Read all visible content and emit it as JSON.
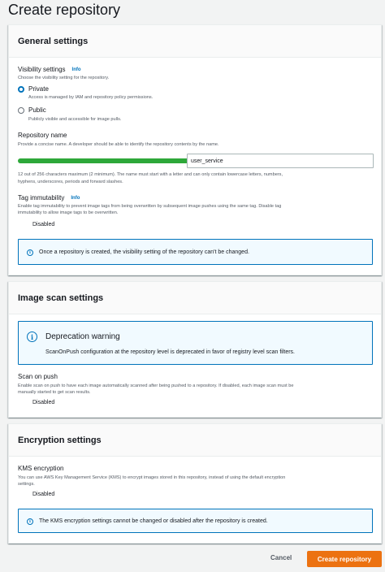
{
  "page": {
    "title": "Create repository"
  },
  "general": {
    "title": "General settings",
    "visibility_label": "Visibility settings",
    "visibility_info": "Info",
    "visibility_desc": "Choose the visibility setting for the repository.",
    "private_label": "Private",
    "private_desc": "Access is managed by IAM and repository policy permissions.",
    "public_label": "Public",
    "public_desc": "Publicly visible and accessible for image pulls.",
    "repo_name_label": "Repository name",
    "repo_name_desc": "Provide a concise name. A developer should be able to identify the repository contents by the name.",
    "repo_prefix_sep": "/",
    "repo_name_value": "user_service",
    "repo_name_hint_1": "12 out of 256 characters maximum (2 minimum). The name must start with a letter and can only contain lowercase letters, numbers,",
    "repo_name_hint_2": "hyphens, underscores, periods and forward slashes.",
    "tag_label": "Tag immutability",
    "tag_info": "Info",
    "tag_desc_1": "Enable tag immutability to prevent image tags from being overwritten by subsequent image pushes using the same tag. Disable tag",
    "tag_desc_2": "immutability to allow image tags to be overwritten.",
    "tag_toggle_label": "Disabled",
    "alert_text": "Once a repository is created, the visibility setting of the repository can't be changed."
  },
  "scan": {
    "title": "Image scan settings",
    "warning_title": "Deprecation warning",
    "warning_text": "ScanOnPush configuration at the repository level is deprecated in favor of registry level scan filters.",
    "scan_label": "Scan on push",
    "scan_desc_1": "Enable scan on push to have each image automatically scanned after being pushed to a repository. If disabled, each image scan must be",
    "scan_desc_2": "manually started to get scan results.",
    "toggle_label": "Disabled"
  },
  "encryption": {
    "title": "Encryption settings",
    "kms_label": "KMS encryption",
    "kms_desc_1": "You can use AWS Key Management Service (KMS) to encrypt images stored in this repository, instead of using the default encryption",
    "kms_desc_2": "settings.",
    "toggle_label": "Disabled",
    "alert_text": "The KMS encryption settings cannot be changed or disabled after the repository is created."
  },
  "footer": {
    "cancel_label": "Cancel",
    "create_label": "Create repository"
  },
  "colors": {
    "primary_button": "#ec7211",
    "info_blue": "#0073bb",
    "redaction_green": "#2ea83a"
  },
  "icons": {
    "alert": "info-circle-icon"
  }
}
